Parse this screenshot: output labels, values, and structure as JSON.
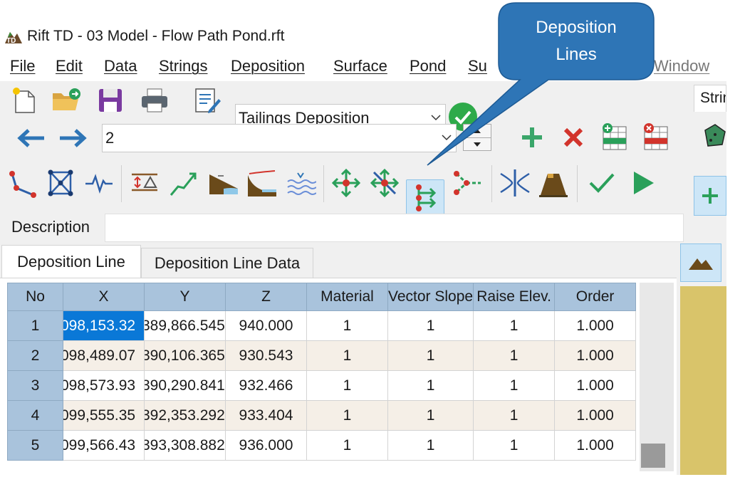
{
  "window": {
    "title": "Rift TD - 03 Model - Flow Path Pond.rft"
  },
  "menu": [
    "File",
    "Edit",
    "Data",
    "Strings",
    "Deposition",
    "Surface",
    "Pond",
    "Su",
    "Window"
  ],
  "toolbar1": {
    "icons": [
      "new-file-icon",
      "open-folder-icon",
      "save-icon",
      "print-icon",
      "edit-document-icon"
    ],
    "mode_combo": "Tailings Deposition",
    "confirm_icon": "green-check-icon"
  },
  "toolbar2": {
    "nav_icons": [
      "back-arrow-icon",
      "forward-arrow-icon"
    ],
    "string_combo": "2",
    "action_icons": [
      "add-icon",
      "delete-icon",
      "add-row-icon",
      "delete-row-icon"
    ]
  },
  "toolbar3": {
    "icons": [
      "polyline-icon",
      "mesh-icon",
      "profile-line-icon",
      "raise-elevation-icon",
      "slope-up-icon",
      "beach-slope-icon",
      "curve-slope-icon",
      "water-level-icon",
      "move-point-icon",
      "delete-point-icon",
      "deposition-lines-icon",
      "branch-lines-icon",
      "merge-lines-icon",
      "dam-icon",
      "validate-check-icon",
      "run-play-icon"
    ]
  },
  "callout": {
    "line1": "Deposition",
    "line2": "Lines"
  },
  "description": {
    "label": "Description",
    "value": ""
  },
  "tabs": [
    "Deposition Line",
    "Deposition Line Data"
  ],
  "table": {
    "headers": [
      "No",
      "X",
      "Y",
      "Z",
      "Material",
      "Vector Slope",
      "Raise Elev.",
      "Order"
    ],
    "rows": [
      [
        "1",
        "098,153.32",
        "389,866.545",
        "940.000",
        "1",
        "1",
        "1",
        "1.000"
      ],
      [
        "2",
        "098,489.07",
        "390,106.365",
        "930.543",
        "1",
        "1",
        "1",
        "1.000"
      ],
      [
        "3",
        "098,573.93",
        "390,290.841",
        "932.466",
        "1",
        "1",
        "1",
        "1.000"
      ],
      [
        "4",
        "099,555.35",
        "392,353.292",
        "933.404",
        "1",
        "1",
        "1",
        "1.000"
      ],
      [
        "5",
        "099,566.43",
        "393,308.882",
        "936.000",
        "1",
        "1",
        "1",
        "1.000"
      ]
    ]
  },
  "right_panel": {
    "tab": "Strings",
    "icons": [
      "polygon-icon",
      "add-node-icon",
      "terrain-icon"
    ]
  },
  "colors": {
    "header_blue": "#a9c3dc",
    "selection": "#0a78d7",
    "callout": "#2e75b6",
    "row_alt": "#f5efe7"
  }
}
